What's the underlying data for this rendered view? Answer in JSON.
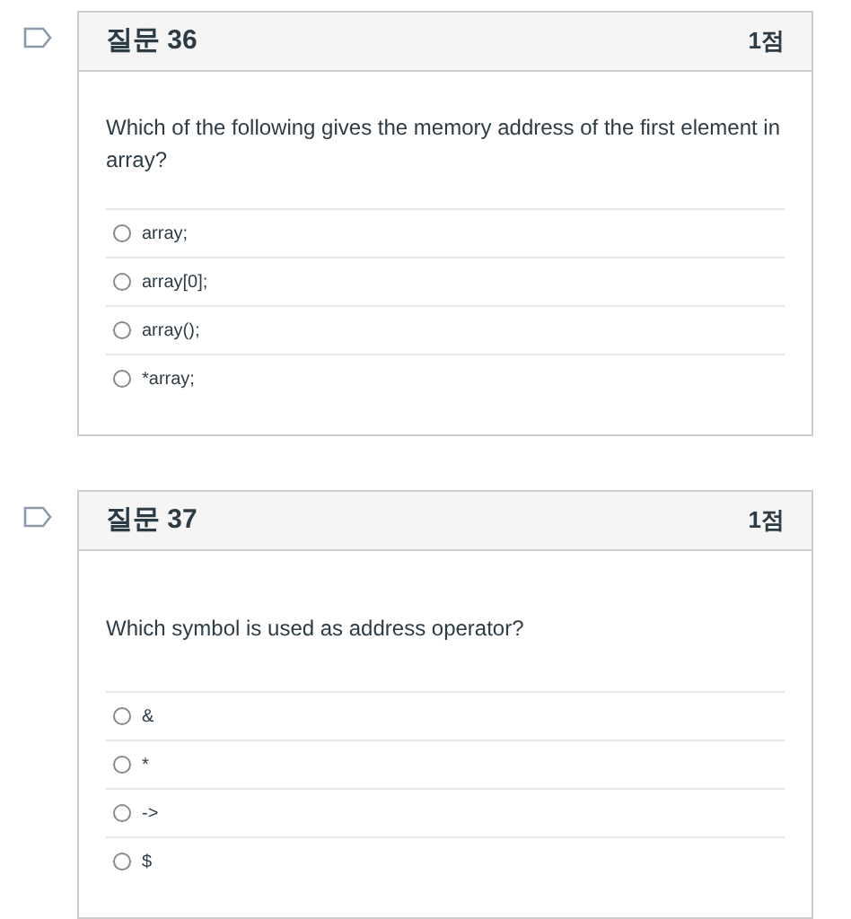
{
  "questions": [
    {
      "title": "질문 36",
      "points": "1점",
      "text": "Which of the following gives the memory address of the first element in array?",
      "options": [
        {
          "label": "array;",
          "selected": false
        },
        {
          "label": "array[0];",
          "selected": false
        },
        {
          "label": "array();",
          "selected": false
        },
        {
          "label": "*array;",
          "selected": false
        }
      ]
    },
    {
      "title": "질문 37",
      "points": "1점",
      "text": "Which symbol is used as address operator?",
      "options": [
        {
          "label": "&",
          "selected": false
        },
        {
          "label": "*",
          "selected": false
        },
        {
          "label": "->",
          "selected": false
        },
        {
          "label": "$",
          "selected": false
        }
      ]
    }
  ]
}
